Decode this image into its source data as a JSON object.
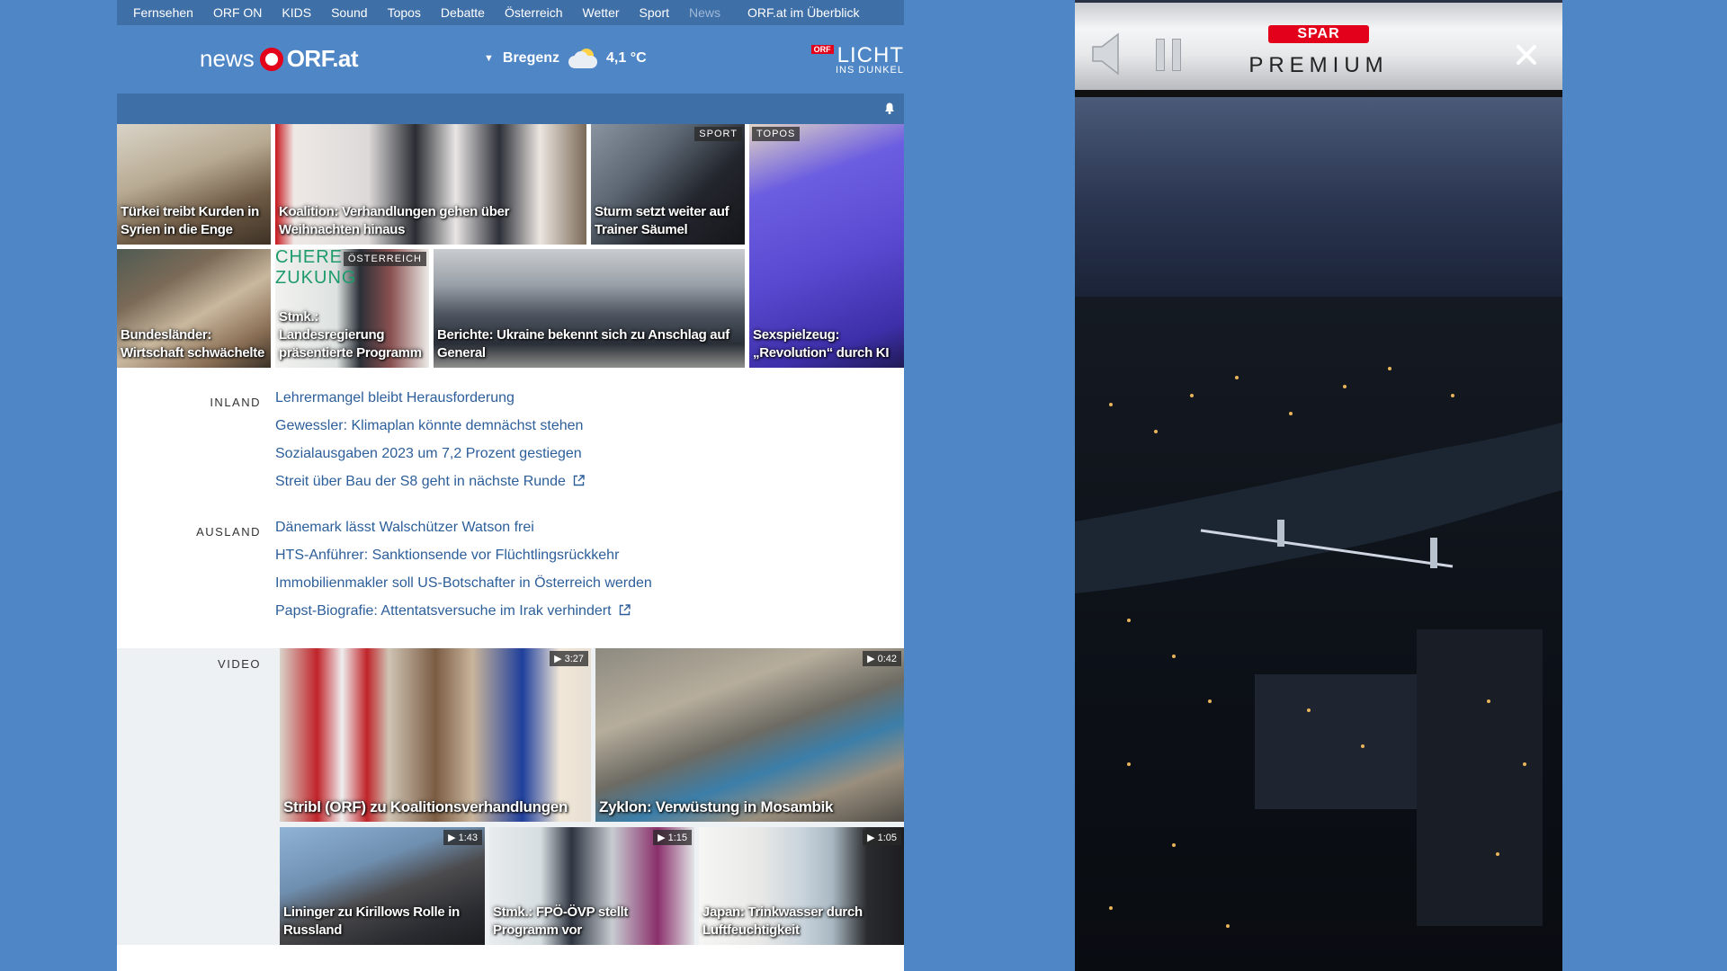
{
  "topnav": [
    "Fernsehen",
    "ORF ON",
    "KIDS",
    "Sound",
    "Topos",
    "Debatte",
    "Österreich",
    "Wetter",
    "Sport",
    "News",
    "ORF.at im Überblick"
  ],
  "header": {
    "logo_news": "news",
    "logo_orf": "ORF.at",
    "weather_location": "Bregenz",
    "weather_temp": "4,1 °C",
    "licht_badge": "ORF",
    "licht_big": "LICHT",
    "licht_small": "INS DUNKEL"
  },
  "tiles": [
    {
      "caption": "Türkei treibt Kurden in Syrien in die Enge",
      "tag": ""
    },
    {
      "caption": "Koalition: Verhandlungen gehen über Weihnachten hinaus",
      "tag": ""
    },
    {
      "caption": "Sturm setzt weiter auf Trainer Säumel",
      "tag": "SPORT"
    },
    {
      "caption": "Sexspielzeug: „Revolution“ durch KI",
      "tag": "TOPOS"
    },
    {
      "caption": "Bundesländer: Wirtschaft schwächelte",
      "tag": ""
    },
    {
      "caption": "Stmk.: Landesregierung präsentierte Programm",
      "tag": "ÖSTERREICH"
    },
    {
      "caption": "Berichte: Ukraine bekennt sich zu Anschlag auf General",
      "tag": ""
    }
  ],
  "tile_overlay_text": "CHERE ZUKUNG",
  "inland": {
    "label": "INLAND",
    "links": [
      "Lehrermangel bleibt Herausforderung",
      "Gewessler: Klimaplan könnte demnächst stehen",
      "Sozialausgaben 2023 um 7,2 Prozent gestiegen",
      "Streit über Bau der S8 geht in nächste Runde"
    ]
  },
  "ausland": {
    "label": "AUSLAND",
    "links": [
      "Dänemark lässt Walschützer Watson frei",
      "HTS-Anführer: Sanktionsende vor Flüchtlingsrückkehr",
      "Immobilienmakler soll US-Botschafter in Österreich werden",
      "Papst-Biografie: Attentatsversuche im Irak verhindert"
    ]
  },
  "video": {
    "label": "VIDEO",
    "items": [
      {
        "caption": "Stribl (ORF) zu Koalitionsverhandlungen",
        "duration": "3:27"
      },
      {
        "caption": "Zyklon: Verwüstung in Mosambik",
        "duration": "0:42"
      },
      {
        "caption": "Lininger zu Kirillows Rolle in Russland",
        "duration": "1:43"
      },
      {
        "caption": "Stmk.: FPÖ-ÖVP stellt Programm vor",
        "duration": "1:15"
      },
      {
        "caption": "Japan: Trinkwasser durch Luftfeuchtigkeit",
        "duration": "1:05"
      }
    ]
  },
  "ad": {
    "brand": "SPAR",
    "title": "PREMIUM"
  },
  "colors": {
    "page_bg": "#4f86c6",
    "nav_bg": "#3f6fa7",
    "link": "#2c5e9a",
    "orf_red": "#e2001a"
  }
}
